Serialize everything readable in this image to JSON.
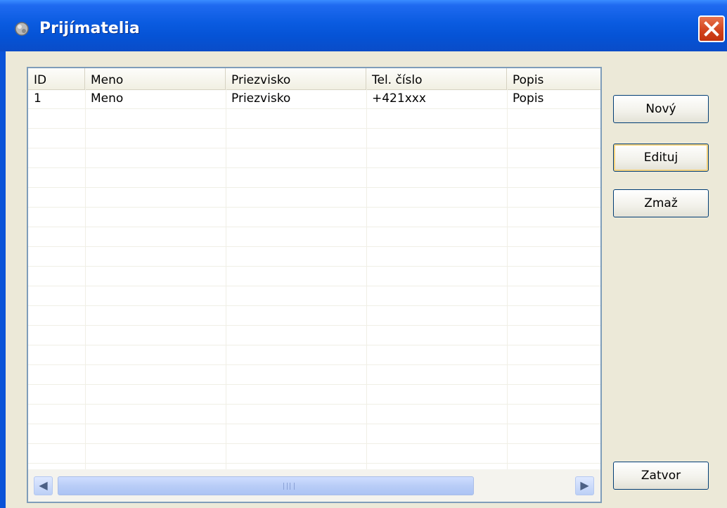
{
  "window": {
    "title": "Prijímatelia"
  },
  "table": {
    "columns": [
      "ID",
      "Meno",
      "Priezvisko",
      "Tel. číslo",
      "Popis"
    ],
    "rows": [
      [
        "1",
        "Meno",
        "Priezvisko",
        "+421xxx",
        "Popis"
      ]
    ]
  },
  "buttons": {
    "new": "Nový",
    "edit": "Edituj",
    "delete": "Zmaž",
    "close": "Zatvor"
  },
  "icons": {
    "title": "app-icon",
    "close": "close-icon",
    "scroll_left": "chevron-left-icon",
    "scroll_right": "chevron-right-icon"
  },
  "colors": {
    "titlebar": "#0a5be0",
    "close": "#d1411a",
    "background": "#ece9d8"
  }
}
